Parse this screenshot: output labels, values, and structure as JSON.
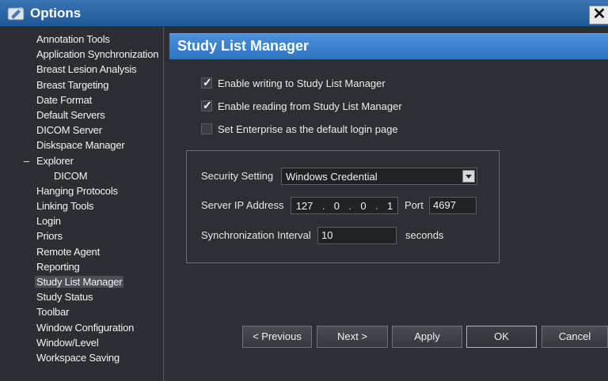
{
  "window": {
    "title": "Options",
    "app_icon": "options-app-icon",
    "close_label": "✕"
  },
  "sidebar": {
    "items": [
      {
        "label": "Annotation Tools"
      },
      {
        "label": "Application Synchronization"
      },
      {
        "label": "Breast Lesion Analysis"
      },
      {
        "label": "Breast Targeting"
      },
      {
        "label": "Date Format"
      },
      {
        "label": "Default Servers"
      },
      {
        "label": "DICOM Server"
      },
      {
        "label": "Diskspace Manager"
      },
      {
        "label": "Explorer",
        "expander": "–"
      },
      {
        "label": "DICOM"
      },
      {
        "label": "Hanging Protocols"
      },
      {
        "label": "Linking Tools"
      },
      {
        "label": "Login"
      },
      {
        "label": "Priors"
      },
      {
        "label": "Remote Agent"
      },
      {
        "label": "Reporting"
      },
      {
        "label": "Study List Manager",
        "selected": true
      },
      {
        "label": "Study Status"
      },
      {
        "label": "Toolbar"
      },
      {
        "label": "Window Configuration"
      },
      {
        "label": "Window/Level"
      },
      {
        "label": "Workspace Saving"
      }
    ]
  },
  "main": {
    "title": "Study List Manager",
    "checkboxes": [
      {
        "label": "Enable writing to Study List Manager",
        "checked": true
      },
      {
        "label": "Enable reading from Study List Manager",
        "checked": true
      },
      {
        "label": "Set Enterprise as the default login page",
        "checked": false
      }
    ],
    "security": {
      "label": "Security Setting",
      "value": "Windows Credential"
    },
    "server": {
      "label": "Server IP Address",
      "ip": [
        "127",
        "0",
        "0",
        "1"
      ],
      "port_label": "Port",
      "port": "4697"
    },
    "sync": {
      "label": "Synchronization Interval",
      "value": "10",
      "unit": "seconds"
    }
  },
  "buttons": {
    "previous": "< Previous",
    "next": "Next >",
    "apply": "Apply",
    "ok": "OK",
    "cancel": "Cancel"
  },
  "colors": {
    "title_bar": "#2a65a8",
    "section_header": "#3a82d0",
    "background": "#2c2f33"
  }
}
